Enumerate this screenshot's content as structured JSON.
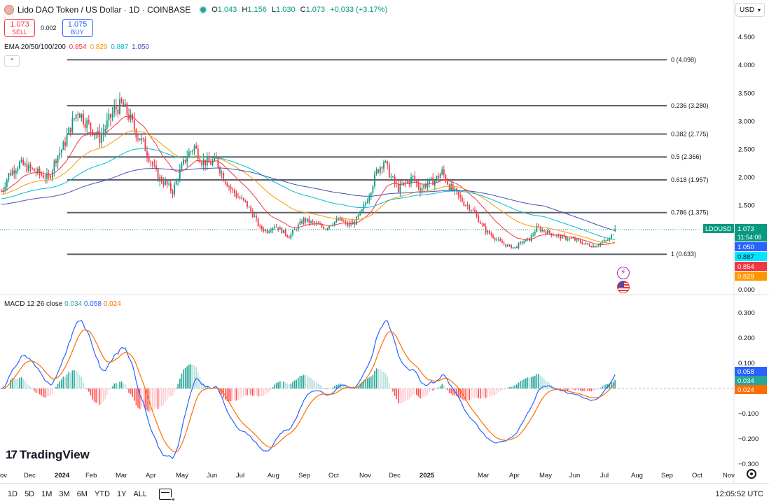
{
  "header": {
    "title": "Lido DAO Token / US Dollar · 1D · COINBASE",
    "ohlc": {
      "o_label": "O",
      "o": "1.043",
      "h_label": "H",
      "h": "1.156",
      "l_label": "L",
      "l": "1.030",
      "c_label": "C",
      "c": "1.073",
      "change": "+0.033 (+3.17%)"
    }
  },
  "trade": {
    "sell_price": "1.073",
    "sell_label": "SELL",
    "spread": "0.002",
    "buy_price": "1.075",
    "buy_label": "BUY"
  },
  "currency": {
    "value": "USD"
  },
  "ema_legend": {
    "label": "EMA 20/50/100/200",
    "v20": "0.854",
    "v50": "0.829",
    "v100": "0.887",
    "v200": "1.050",
    "colors": {
      "ema20": "#f23645",
      "ema50": "#ff9800",
      "ema100": "#00bcd4",
      "ema200": "#3f51b5"
    }
  },
  "macd_legend": {
    "label": "MACD 12 26 close",
    "hist": "0.034",
    "macd": "0.058",
    "signal": "0.024"
  },
  "price_axis": {
    "ticks": [
      "4.500",
      "4.000",
      "3.500",
      "3.000",
      "2.500",
      "2.000",
      "1.500",
      "0.000"
    ],
    "symbol_label": "LDOUSD",
    "last_price": "1.073",
    "countdown": "11:54:08",
    "ema200_tag": "1.050",
    "ema100_tag": "0.887",
    "ema20_tag": "0.854",
    "ema50_tag": "0.829"
  },
  "macd_axis": {
    "ticks": [
      "0.300",
      "0.200",
      "0.100",
      "−0.100",
      "−0.200",
      "−0.300"
    ],
    "macd_tag": "0.058",
    "hist_tag": "0.034",
    "signal_tag": "0.024"
  },
  "fib": [
    {
      "level": "0 (4.098)",
      "price": 4.098
    },
    {
      "level": "0.236 (3.280)",
      "price": 3.28
    },
    {
      "level": "0.382 (2.775)",
      "price": 2.775
    },
    {
      "level": "0.5 (2.366)",
      "price": 2.366
    },
    {
      "level": "0.618 (1.957)",
      "price": 1.957
    },
    {
      "level": "0.786 (1.375)",
      "price": 1.375
    },
    {
      "level": "1 (0.633)",
      "price": 0.633
    }
  ],
  "time_axis": [
    "ov",
    "Dec",
    "2024",
    "Feb",
    "Mar",
    "Apr",
    "May",
    "Jun",
    "Jul",
    "Aug",
    "Sep",
    "Oct",
    "Nov",
    "Dec",
    "2025",
    "Mar",
    "Apr",
    "May",
    "Jun",
    "Jul",
    "Aug",
    "Sep",
    "Oct",
    "Nov"
  ],
  "logo": {
    "text": "TradingView"
  },
  "ranges": [
    "1D",
    "5D",
    "1M",
    "3M",
    "6M",
    "YTD",
    "1Y",
    "ALL"
  ],
  "clock": "12:05:52 UTC",
  "chart_data": {
    "type": "candlestick",
    "symbol": "LDOUSD",
    "interval": "1D",
    "y_ticks": [
      0,
      1.5,
      2,
      2.5,
      3,
      3.5,
      4,
      4.5
    ],
    "close_series": [
      [
        0,
        1.75
      ],
      [
        4,
        2.05
      ],
      [
        10,
        2.25
      ],
      [
        16,
        2.15
      ],
      [
        22,
        2.05
      ],
      [
        26,
        1.98
      ],
      [
        30,
        2.35
      ],
      [
        34,
        2.55
      ],
      [
        38,
        2.9
      ],
      [
        42,
        3.2
      ],
      [
        46,
        3.0
      ],
      [
        50,
        2.85
      ],
      [
        54,
        2.7
      ],
      [
        58,
        2.95
      ],
      [
        62,
        3.2
      ],
      [
        66,
        3.3
      ],
      [
        70,
        3.1
      ],
      [
        74,
        2.8
      ],
      [
        78,
        2.6
      ],
      [
        82,
        2.3
      ],
      [
        86,
        2.0
      ],
      [
        90,
        1.9
      ],
      [
        94,
        1.75
      ],
      [
        98,
        2.1
      ],
      [
        102,
        2.4
      ],
      [
        106,
        2.55
      ],
      [
        110,
        2.3
      ],
      [
        114,
        2.25
      ],
      [
        118,
        2.3
      ],
      [
        122,
        2.0
      ],
      [
        126,
        1.8
      ],
      [
        130,
        1.65
      ],
      [
        134,
        1.55
      ],
      [
        138,
        1.35
      ],
      [
        142,
        1.1
      ],
      [
        146,
        1.05
      ],
      [
        150,
        1.15
      ],
      [
        154,
        1.05
      ],
      [
        158,
        0.95
      ],
      [
        162,
        1.1
      ],
      [
        166,
        1.25
      ],
      [
        170,
        1.2
      ],
      [
        174,
        1.15
      ],
      [
        178,
        1.1
      ],
      [
        182,
        1.2
      ],
      [
        186,
        1.25
      ],
      [
        190,
        1.15
      ],
      [
        194,
        1.2
      ],
      [
        198,
        1.4
      ],
      [
        202,
        1.7
      ],
      [
        206,
        2.1
      ],
      [
        210,
        2.3
      ],
      [
        214,
        2.0
      ],
      [
        218,
        1.8
      ],
      [
        222,
        1.9
      ],
      [
        226,
        2.0
      ],
      [
        230,
        1.8
      ],
      [
        234,
        1.9
      ],
      [
        238,
        1.95
      ],
      [
        242,
        2.1
      ],
      [
        246,
        1.85
      ],
      [
        250,
        1.7
      ],
      [
        254,
        1.55
      ],
      [
        258,
        1.45
      ],
      [
        262,
        1.25
      ],
      [
        266,
        1.05
      ],
      [
        270,
        0.95
      ],
      [
        274,
        0.85
      ],
      [
        278,
        0.78
      ],
      [
        282,
        0.75
      ],
      [
        286,
        0.85
      ],
      [
        290,
        0.9
      ],
      [
        294,
        1.1
      ],
      [
        298,
        1.05
      ],
      [
        302,
        1.0
      ],
      [
        306,
        0.95
      ],
      [
        310,
        0.92
      ],
      [
        314,
        0.9
      ],
      [
        318,
        0.85
      ],
      [
        322,
        0.8
      ],
      [
        326,
        0.78
      ],
      [
        330,
        0.85
      ],
      [
        334,
        0.9
      ],
      [
        337,
        1.073
      ]
    ],
    "ema_last": {
      "ema20": 0.854,
      "ema50": 0.829,
      "ema100": 0.887,
      "ema200": 1.05
    },
    "ohlc_last": {
      "open": 1.043,
      "high": 1.156,
      "low": 1.03,
      "close": 1.073
    },
    "macd_last": {
      "macd": 0.058,
      "signal": 0.024,
      "histogram": 0.034
    }
  }
}
